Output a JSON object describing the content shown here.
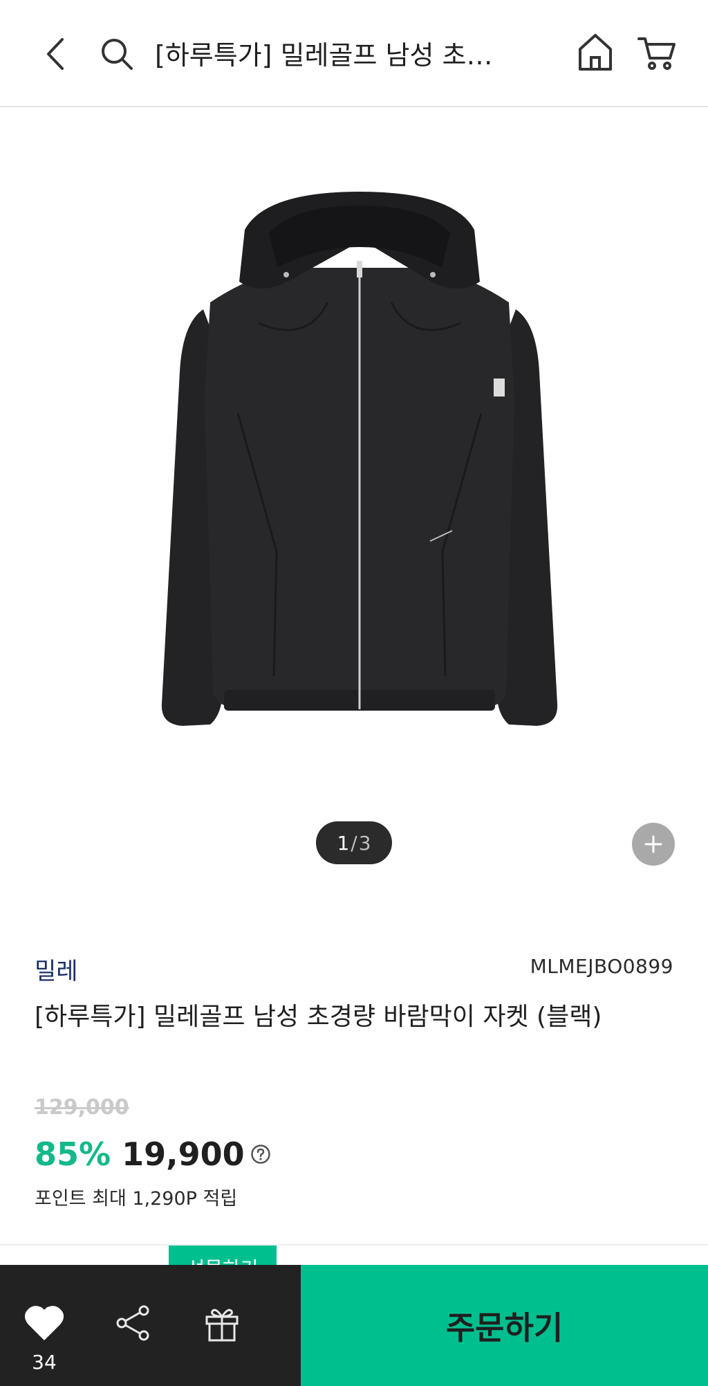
{
  "header": {
    "title": "[하루특가] 밀레골프 남성 초…"
  },
  "gallery": {
    "current_page": "1",
    "separator": "/",
    "total_pages": "3"
  },
  "product": {
    "brand": "밀레",
    "sku": "MLMEJBO0899",
    "title": "[하루특가] 밀레골프 남성 초경량 바람막이 자켓 (블랙)",
    "original_price": "129,000",
    "discount": "85%",
    "price": "19,900",
    "points": "포인트 최대 1,290P 적립"
  },
  "bottom_bar": {
    "like_count": "34",
    "gift_tooltip": "선물하기",
    "order_label": "주문하기"
  },
  "colors": {
    "accent": "#00bf8f",
    "discount": "#14b88a",
    "brand": "#1c2f66",
    "bar_dark": "#222222"
  },
  "icons": [
    "back-icon",
    "search-icon",
    "home-icon",
    "cart-icon",
    "plus-icon",
    "question-icon",
    "heart-icon",
    "share-icon",
    "gift-icon"
  ]
}
